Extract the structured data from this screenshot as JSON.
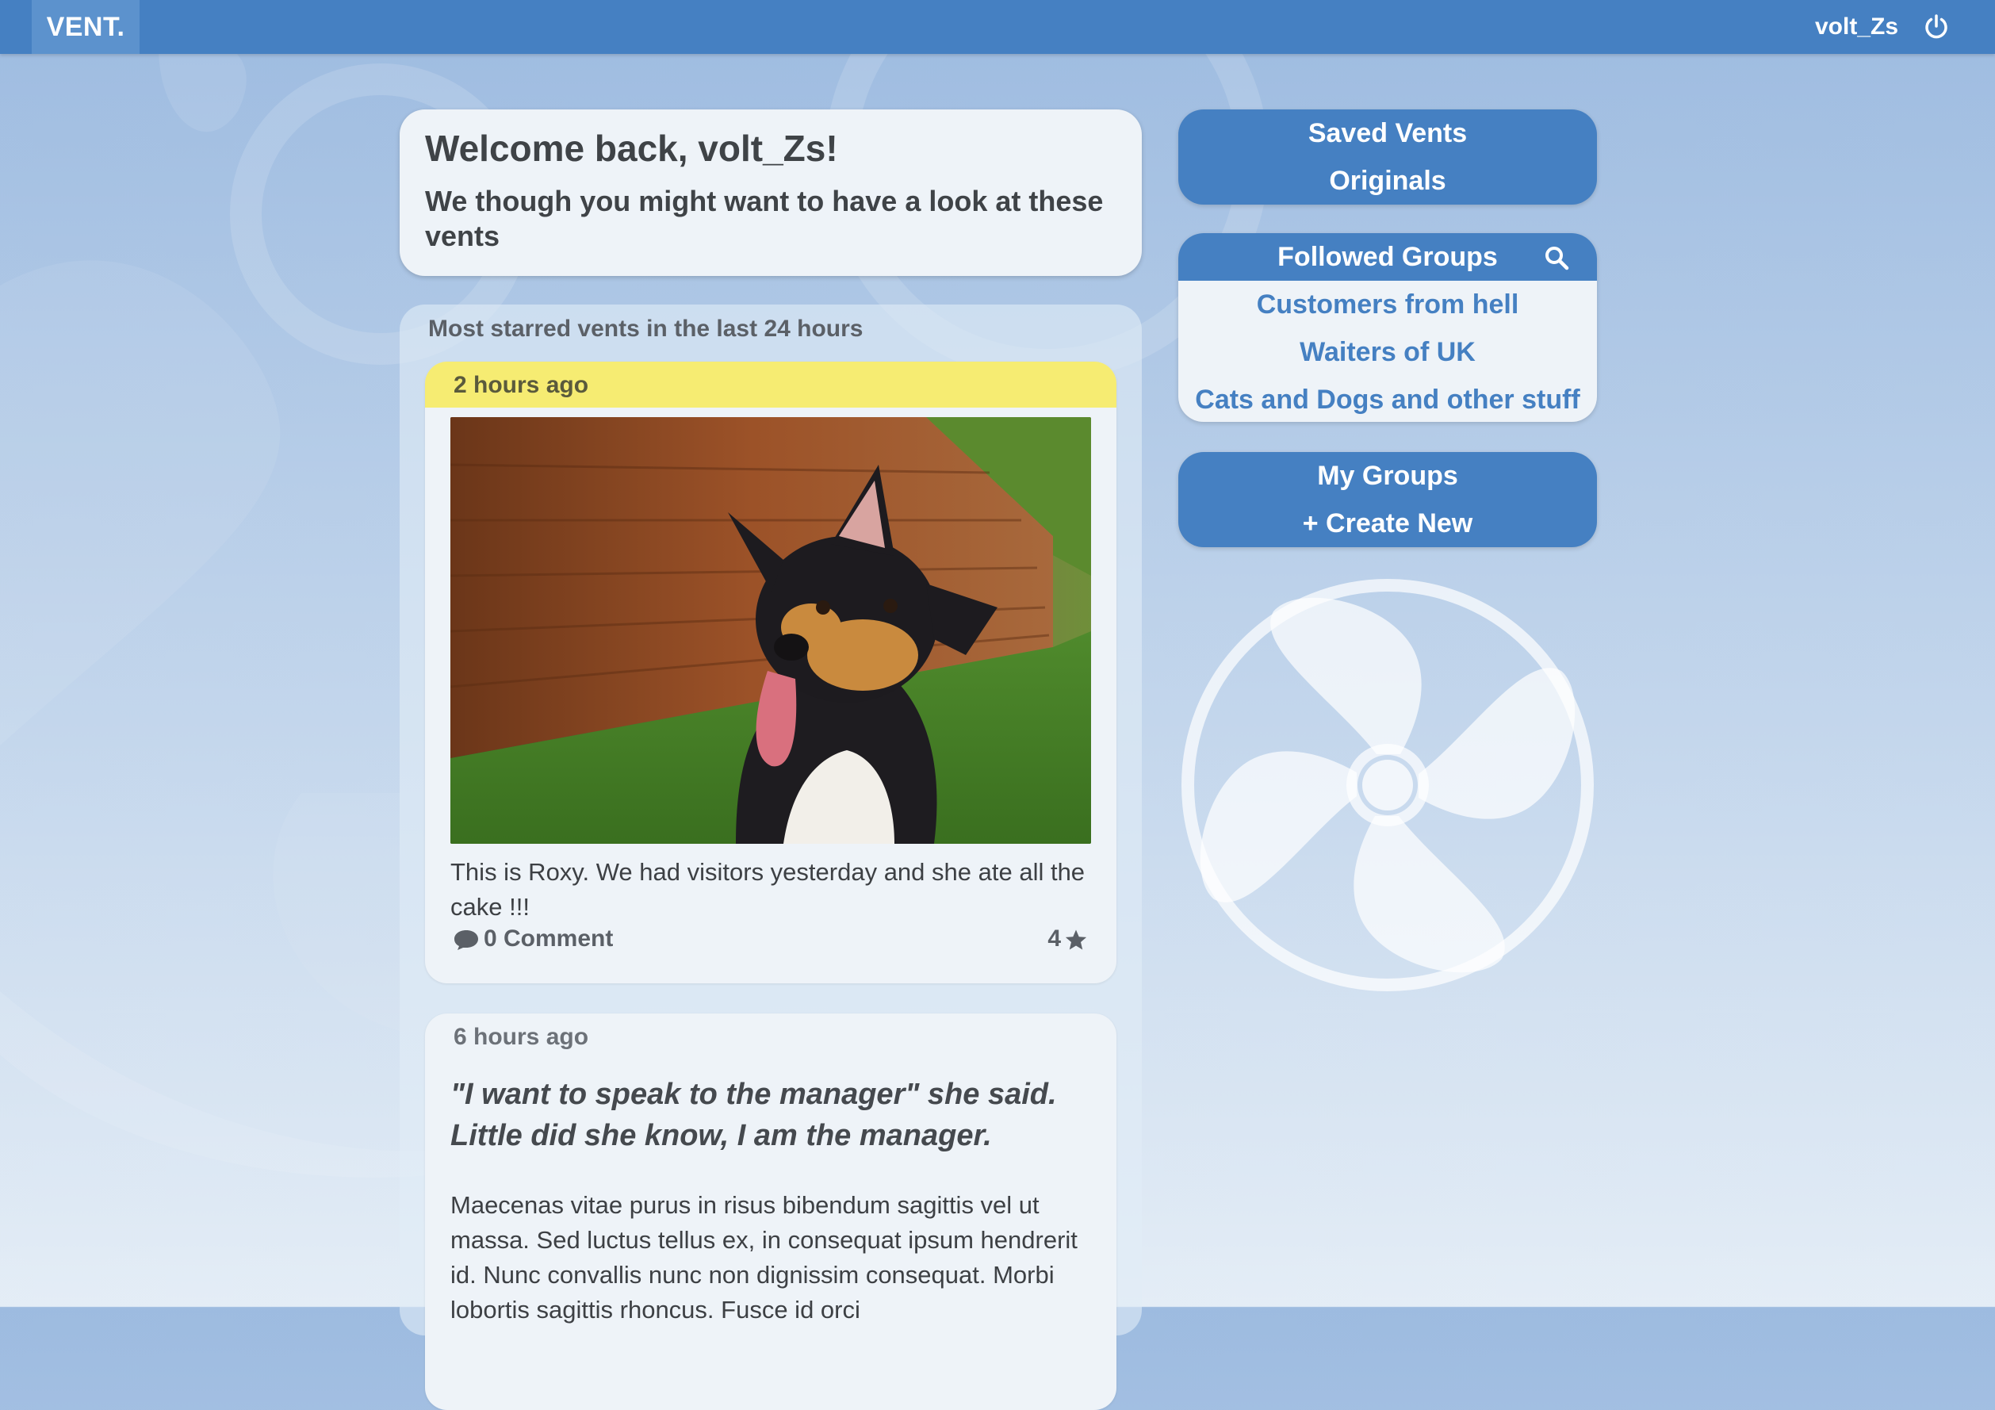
{
  "app": {
    "brand": "VENT.",
    "username": "volt_Zs"
  },
  "icons": {
    "power": "power-icon",
    "search": "search-icon",
    "comment": "comment-icon",
    "star": "star-icon",
    "fan": "fan-logo-icon"
  },
  "colors": {
    "primary": "#4580c2",
    "highlight": "#f6ec72",
    "card": "#eef3f8"
  },
  "welcome": {
    "title": "Welcome back, volt_Zs!",
    "subtitle": "We though you might want to have a look at these vents"
  },
  "feed": {
    "title": "Most starred vents in the last 24 hours",
    "vents": [
      {
        "time": "2 hours ago",
        "text": "This is Roxy. We had visitors yesterday and she ate all the cake !!!",
        "comments": "0 Comment",
        "stars": "4"
      },
      {
        "time": "6 hours ago",
        "quote": "\"I want to speak to the manager\" she said. Little did she know, I am the manager.",
        "body": "Maecenas vitae purus in risus bibendum sagittis vel ut massa. Sed luctus tellus ex, in consequat ipsum hendrerit id. Nunc convallis nunc non dignissim consequat. Morbi lobortis sagittis rhoncus. Fusce id orci"
      }
    ]
  },
  "sidebar": {
    "saved_vents": "Saved Vents",
    "originals": "Originals",
    "followed_groups": {
      "title": "Followed Groups",
      "items": [
        "Customers from hell",
        "Waiters of UK",
        "Cats and Dogs and other stuff"
      ]
    },
    "my_groups": "My Groups",
    "create_new": "+ Create New"
  }
}
